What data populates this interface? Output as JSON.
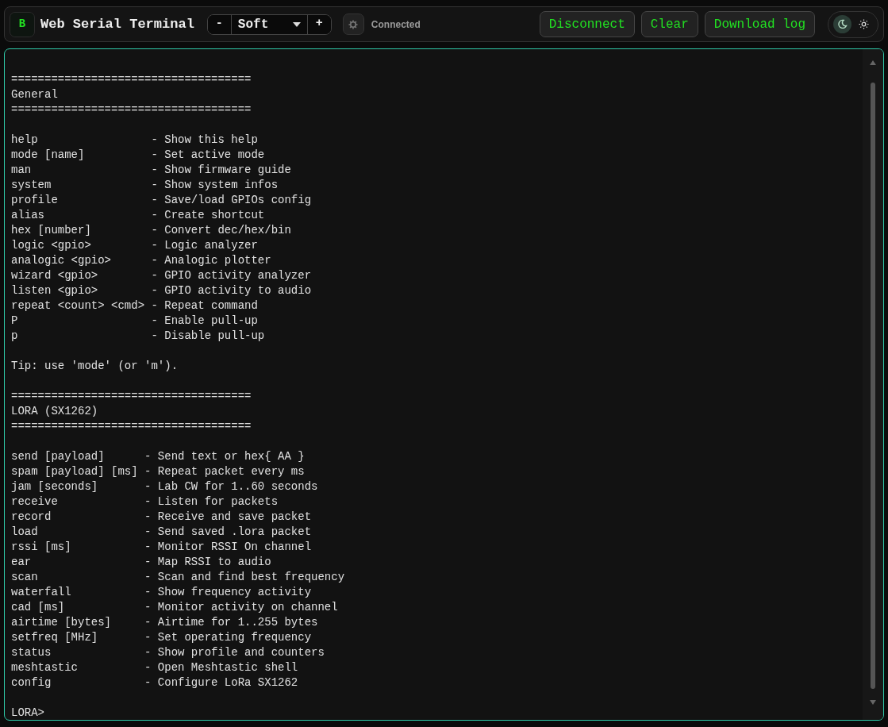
{
  "header": {
    "logo": "B",
    "title": "Web Serial Terminal",
    "font_stepper": {
      "decrease": "-",
      "value": "Soft",
      "increase": "+"
    },
    "status": "Connected",
    "buttons": [
      "Disconnect",
      "Clear",
      "Download log"
    ],
    "theme_toggle": [
      {
        "kind": "moon",
        "selected": true
      },
      {
        "kind": "sun",
        "selected": false
      }
    ]
  },
  "terminal": {
    "blocks": [
      {
        "lines": [
          "====================================",
          "General",
          "===================================="
        ]
      },
      {
        "lines": [
          "help                 - Show this help",
          "mode [name]          - Set active mode",
          "man                  - Show firmware guide",
          "system               - Show system infos",
          "profile              - Save/load GPIOs config",
          "alias                - Create shortcut",
          "hex [number]         - Convert dec/hex/bin",
          "logic <gpio>         - Logic analyzer",
          "analogic <gpio>      - Analogic plotter",
          "wizard <gpio>        - GPIO activity analyzer",
          "listen <gpio>        - GPIO activity to audio",
          "repeat <count> <cmd> - Repeat command",
          "P                    - Enable pull-up",
          "p                    - Disable pull-up"
        ]
      },
      {
        "lines": [
          "Tip: use 'mode' (or 'm')."
        ]
      },
      {
        "lines": [
          "====================================",
          "LORA (SX1262)",
          "===================================="
        ]
      },
      {
        "lines": [
          "send [payload]      - Send text or hex{ AA }",
          "spam [payload] [ms] - Repeat packet every ms",
          "jam [seconds]       - Lab CW for 1..60 seconds",
          "receive             - Listen for packets",
          "record              - Receive and save packet",
          "load                - Send saved .lora packet",
          "rssi [ms]           - Monitor RSSI On channel",
          "ear                 - Map RSSI to audio",
          "scan                - Scan and find best frequency",
          "waterfall           - Show frequency activity",
          "cad [ms]            - Monitor activity on channel",
          "airtime [bytes]     - Airtime for 1..255 bytes",
          "setfreq [MHz]       - Set operating frequency",
          "status              - Show profile and counters",
          "meshtastic          - Open Meshtastic shell",
          "config              - Configure LoRa SX1262"
        ]
      },
      {
        "lines": [
          "LORA>"
        ]
      }
    ]
  }
}
